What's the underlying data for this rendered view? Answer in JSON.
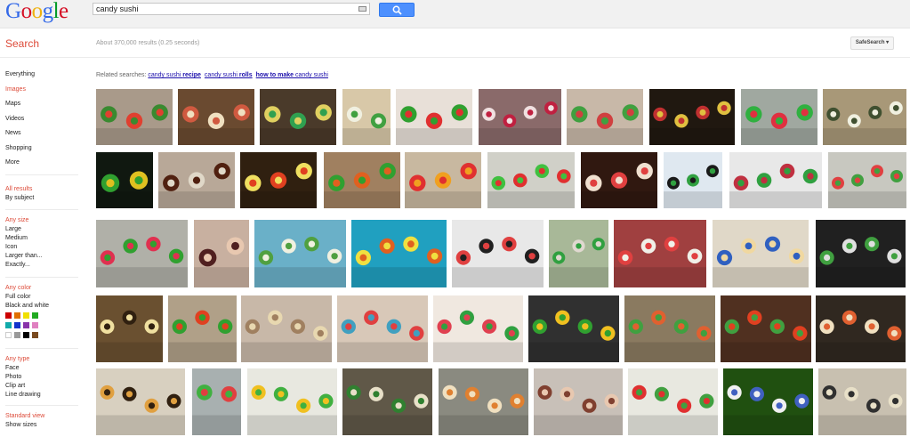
{
  "header": {
    "logo": "Google",
    "logo_letters": [
      {
        "char": "G",
        "color": "#3369e8"
      },
      {
        "char": "o",
        "color": "#d50f25"
      },
      {
        "char": "o",
        "color": "#eeb211"
      },
      {
        "char": "g",
        "color": "#3369e8"
      },
      {
        "char": "l",
        "color": "#009925"
      },
      {
        "char": "e",
        "color": "#d50f25"
      }
    ],
    "search_value": "candy sushi",
    "search_button_icon": "magnifier-icon",
    "keyboard_icon": "keyboard-icon"
  },
  "subbar": {
    "title": "Search",
    "result_stats": "About 370,000 results (0.25 seconds)",
    "safesearch_label": "SafeSearch ▾"
  },
  "sidebar": {
    "nav": [
      "Everything",
      "Images",
      "Maps",
      "Videos",
      "News",
      "Shopping",
      "More"
    ],
    "active_nav": "Images",
    "results": {
      "head": "All results",
      "by_subject": "By subject"
    },
    "size": {
      "head": "Any size",
      "options": [
        "Large",
        "Medium",
        "Icon",
        "Larger than...",
        "Exactly..."
      ]
    },
    "color": {
      "head": "Any color",
      "options": [
        "Full color",
        "Black and white"
      ],
      "swatches": [
        "#cc0000",
        "#e07000",
        "#f0e000",
        "#22aa22",
        "#11aaaa",
        "#1133cc",
        "#8833aa",
        "#e080c0",
        "#ffffff",
        "#999999",
        "#000000",
        "#7a4a20"
      ]
    },
    "type": {
      "head": "Any type",
      "options": [
        "Face",
        "Photo",
        "Clip art",
        "Line drawing"
      ]
    },
    "view": {
      "head": "Standard view",
      "options": [
        "Show sizes"
      ]
    }
  },
  "related": {
    "label": "Related searches:",
    "links": [
      {
        "pre": "candy sushi ",
        "bold": "recipe",
        "post": ""
      },
      {
        "pre": "candy sushi ",
        "bold": "rolls",
        "post": ""
      },
      {
        "pre": "",
        "bold": "how to make",
        "post": " candy sushi"
      }
    ]
  },
  "image_rows": [
    [
      {
        "bg": "#a99a8a",
        "c1": "#e04030",
        "c2": "#3a8a30"
      },
      {
        "bg": "#6a4a30",
        "c1": "#f0e0c0",
        "c2": "#d05a40"
      },
      {
        "bg": "#4a3a2a",
        "c1": "#30a050",
        "c2": "#e0d060"
      },
      {
        "bg": "#d8c8a8",
        "c1": "#40a040",
        "c2": "#f0f0e0"
      },
      {
        "bg": "#e8e0d8",
        "c1": "#e03030",
        "c2": "#30a030"
      },
      {
        "bg": "#8a6a6a",
        "c1": "#c02040",
        "c2": "#f0e0e0"
      },
      {
        "bg": "#c8b8a8",
        "c1": "#d04040",
        "c2": "#40a040"
      },
      {
        "bg": "#201810",
        "c1": "#e0c040",
        "c2": "#c03030"
      },
      {
        "bg": "#a0a8a0",
        "c1": "#e03040",
        "c2": "#30b040"
      },
      {
        "bg": "#a89878",
        "c1": "#f0f0e0",
        "c2": "#405030"
      }
    ],
    [
      {
        "bg": "#101810",
        "c1": "#e0c020",
        "c2": "#30a030"
      },
      {
        "bg": "#b8a898",
        "c1": "#e0d8c8",
        "c2": "#502010"
      },
      {
        "bg": "#302010",
        "c1": "#e04020",
        "c2": "#f0e060"
      },
      {
        "bg": "#a08060",
        "c1": "#e06020",
        "c2": "#30a030"
      },
      {
        "bg": "#c8b8a0",
        "c1": "#f0a020",
        "c2": "#e03030"
      },
      {
        "bg": "#d0d0c8",
        "c1": "#e03030",
        "c2": "#40c040"
      },
      {
        "bg": "#301810",
        "c1": "#e04040",
        "c2": "#f0e0d0"
      },
      {
        "bg": "#dfe8f0",
        "c1": "#30a040",
        "c2": "#1a1a1a"
      },
      {
        "bg": "#e8e8e8",
        "c1": "#30a040",
        "c2": "#c03040"
      },
      {
        "bg": "#c8c8c0",
        "c1": "#40a040",
        "c2": "#e04040"
      }
    ],
    [
      {
        "bg": "#b0b0a8",
        "c1": "#30a030",
        "c2": "#e03050"
      },
      {
        "bg": "#c8b0a0",
        "c1": "#e8c8b0",
        "c2": "#502020"
      },
      {
        "bg": "#6ab0c8",
        "c1": "#f0f0e0",
        "c2": "#50a040"
      },
      {
        "bg": "#20a0c0",
        "c1": "#e06020",
        "c2": "#f0e040"
      },
      {
        "bg": "#e8e8e8",
        "c1": "#202020",
        "c2": "#e04040"
      },
      {
        "bg": "#a8b898",
        "c1": "#e0d8d0",
        "c2": "#30a040"
      },
      {
        "bg": "#a04040",
        "c1": "#f0f0e8",
        "c2": "#e04040"
      },
      {
        "bg": "#e0d8c8",
        "c1": "#f0d8a0",
        "c2": "#3060c0"
      },
      {
        "bg": "#202020",
        "c1": "#e0e0e0",
        "c2": "#40a040"
      }
    ],
    [
      {
        "bg": "#6a5030",
        "c1": "#302010",
        "c2": "#f0e0a0"
      },
      {
        "bg": "#b0a088",
        "c1": "#e04020",
        "c2": "#30a030"
      },
      {
        "bg": "#c8b8a8",
        "c1": "#e8d8b0",
        "c2": "#a08060"
      },
      {
        "bg": "#d8c8b8",
        "c1": "#e04040",
        "c2": "#40a0c0"
      },
      {
        "bg": "#f0e8e0",
        "c1": "#30a040",
        "c2": "#e04050"
      },
      {
        "bg": "#303030",
        "c1": "#f0c020",
        "c2": "#30a030"
      },
      {
        "bg": "#8a7a60",
        "c1": "#e06030",
        "c2": "#40a040"
      },
      {
        "bg": "#503020",
        "c1": "#e04020",
        "c2": "#40a040"
      },
      {
        "bg": "#302820",
        "c1": "#e06030",
        "c2": "#f0e0c0"
      }
    ],
    [
      {
        "bg": "#d8d0c0",
        "c1": "#302010",
        "c2": "#e0a040"
      },
      {
        "bg": "#a8b0b0",
        "c1": "#e04040",
        "c2": "#40b040"
      },
      {
        "bg": "#e8e8e0",
        "c1": "#40b040",
        "c2": "#f0c020"
      },
      {
        "bg": "#605848",
        "c1": "#e8e0c8",
        "c2": "#308030"
      },
      {
        "bg": "#8a8a80",
        "c1": "#e08030",
        "c2": "#f0e0c0"
      },
      {
        "bg": "#c8c0b8",
        "c1": "#e8c8b0",
        "c2": "#804030"
      },
      {
        "bg": "#e8e8e0",
        "c1": "#40a040",
        "c2": "#e03030"
      },
      {
        "bg": "#205010",
        "c1": "#4060c0",
        "c2": "#f0f0f0"
      },
      {
        "bg": "#c8c0b0",
        "c1": "#e8e0c8",
        "c2": "#303030"
      }
    ]
  ]
}
